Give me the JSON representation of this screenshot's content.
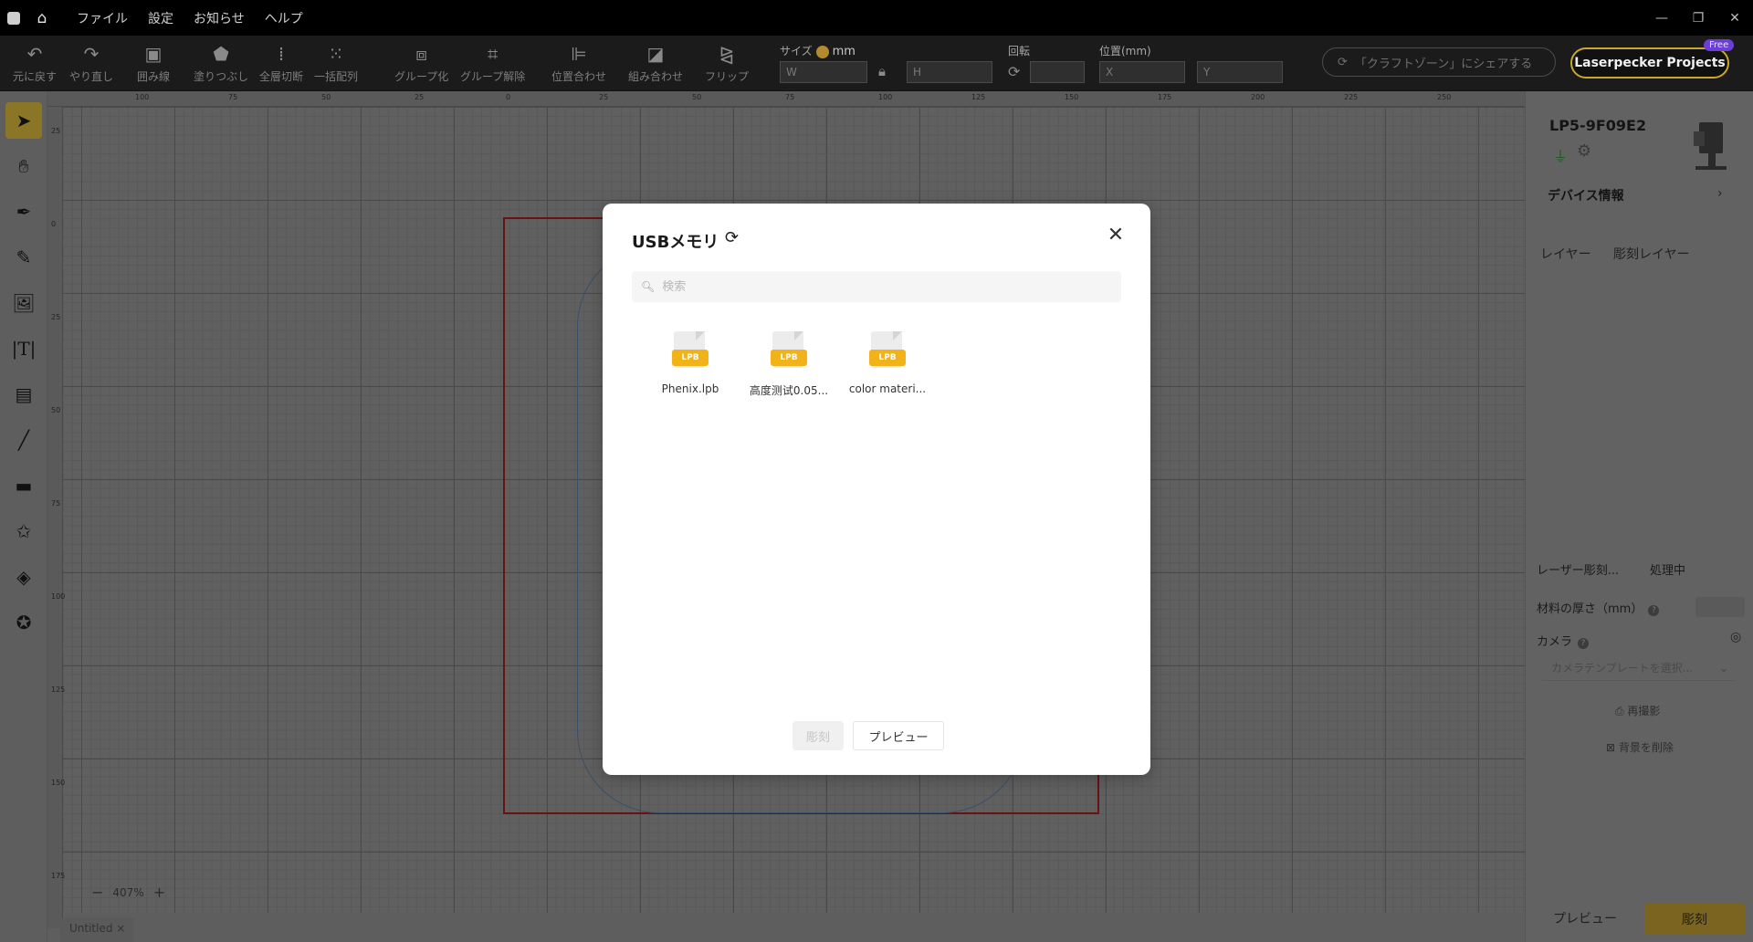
{
  "titlebar": {
    "menus": [
      "ファイル",
      "設定",
      "お知らせ",
      "ヘルプ"
    ],
    "window": {
      "minimize": "—",
      "restore": "❐",
      "close": "✕"
    }
  },
  "toolbar": {
    "undo": "元に戻す",
    "redo": "やり直し",
    "outline": "囲み線",
    "fill": "塗りつぶし",
    "cut_all": "全層切断",
    "array": "一括配列",
    "group": "グループ化",
    "ungroup": "グループ解除",
    "align": "位置合わせ",
    "combine": "組み合わせ",
    "flip": "フリップ",
    "size_label": "サイズ",
    "unit": "mm",
    "w_placeholder": "W",
    "h_placeholder": "H",
    "rotate_label": "回転",
    "position_label": "位置(mm)",
    "x_placeholder": "X",
    "y_placeholder": "Y",
    "share_text": "「クラフトゾーン」にシェアする",
    "projects_button": "Laserpecker Projects",
    "free_badge": "Free"
  },
  "rulers": {
    "top": [
      "100",
      "75",
      "50",
      "25",
      "0",
      "25",
      "50",
      "75",
      "100",
      "125",
      "150",
      "175",
      "200",
      "225",
      "250"
    ],
    "left": [
      "25",
      "0",
      "25",
      "50",
      "75",
      "100",
      "125",
      "150",
      "175"
    ]
  },
  "canvas": {
    "zoom": "407%",
    "doc_tab": "Untitled ×"
  },
  "right_panel": {
    "device_name": "LP5-9F09E2",
    "device_info": "デバイス情報",
    "tabs": [
      "レイヤー",
      "彫刻レイヤー"
    ],
    "laser_section": "レーザー彫刻...",
    "processing": "処理中",
    "material_thickness": "材料の厚さ（mm）",
    "camera": "カメラ",
    "camera_template_placeholder": "カメラテンプレートを選択...",
    "retake": "再撮影",
    "remove_background": "背景を削除",
    "preview": "プレビュー",
    "engrave": "彫刻"
  },
  "modal": {
    "title": "USBメモリ",
    "search_placeholder": "検索",
    "files": [
      {
        "name": "Phenix.lpb",
        "type": "LPB"
      },
      {
        "name": "高度测试0.05...",
        "type": "LPB"
      },
      {
        "name": "color materi...",
        "type": "LPB"
      }
    ],
    "engrave_button": "彫刻",
    "preview_button": "プレビュー"
  },
  "colors": {
    "accent": "#c9a92a",
    "file_badge": "#f2b21a",
    "free_badge": "#6a3fd8"
  }
}
